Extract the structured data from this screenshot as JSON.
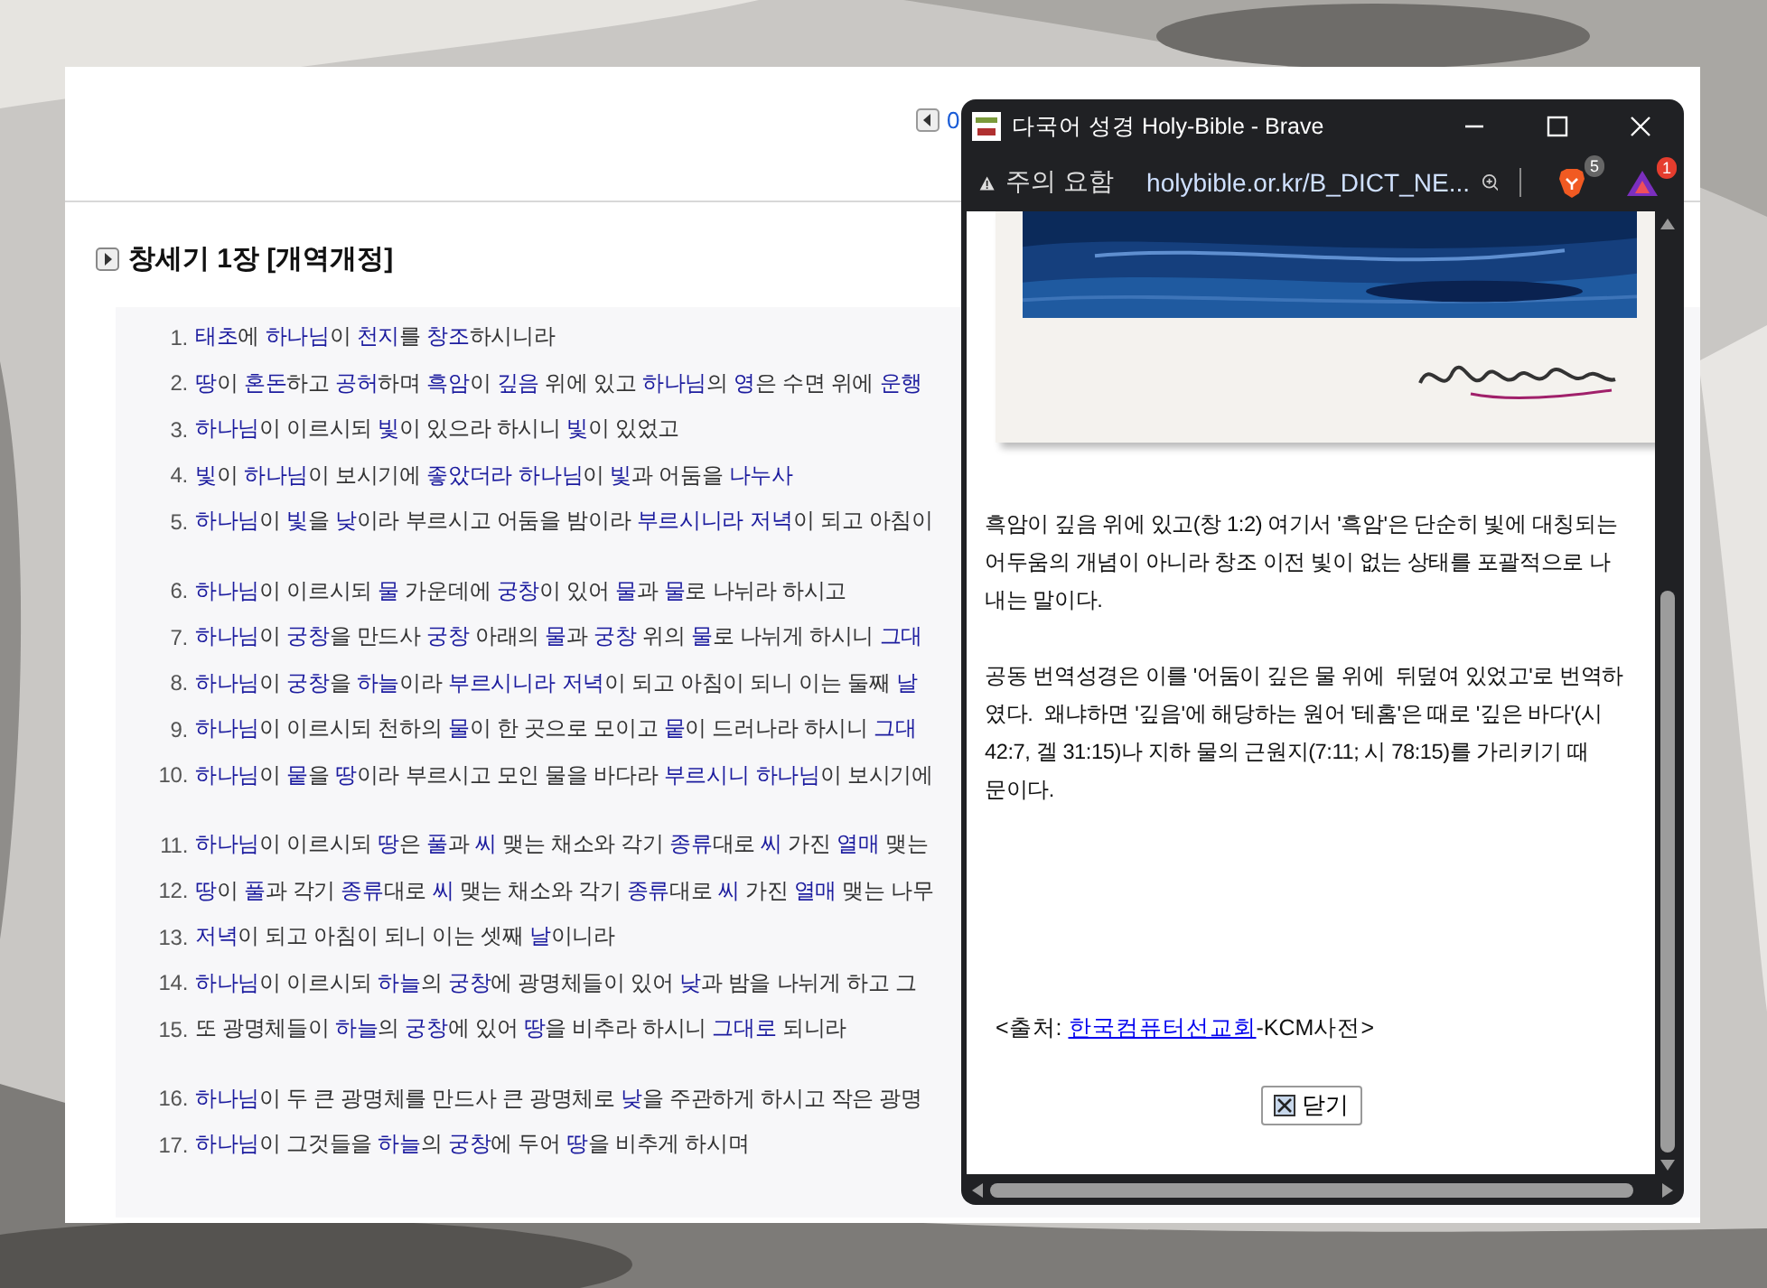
{
  "page": {
    "top_link": "0",
    "heading": "창세기 1장 [개역개정]",
    "verse_groups": [
      [
        {
          "number": "1.",
          "parts": [
            {
              "text": "태초",
              "link": true
            },
            {
              "text": "에 ",
              "link": false
            },
            {
              "text": "하나님",
              "link": true
            },
            {
              "text": "이 ",
              "link": false
            },
            {
              "text": "천지",
              "link": true
            },
            {
              "text": "를 ",
              "link": false
            },
            {
              "text": "창조",
              "link": true
            },
            {
              "text": "하시니라",
              "link": false
            }
          ]
        },
        {
          "number": "2.",
          "parts": [
            {
              "text": "땅",
              "link": true
            },
            {
              "text": "이 ",
              "link": false
            },
            {
              "text": "혼돈",
              "link": true
            },
            {
              "text": "하고 ",
              "link": false
            },
            {
              "text": "공허",
              "link": true
            },
            {
              "text": "하며 ",
              "link": false
            },
            {
              "text": "흑암",
              "link": true
            },
            {
              "text": "이 ",
              "link": false
            },
            {
              "text": "깊음",
              "link": true
            },
            {
              "text": " 위에 있고 ",
              "link": false
            },
            {
              "text": "하나님",
              "link": true
            },
            {
              "text": "의 ",
              "link": false
            },
            {
              "text": "영",
              "link": true
            },
            {
              "text": "은 수면 위에 ",
              "link": false
            },
            {
              "text": "운행",
              "link": true
            }
          ]
        },
        {
          "number": "3.",
          "parts": [
            {
              "text": "하나님",
              "link": true
            },
            {
              "text": "이 이르시되 ",
              "link": false
            },
            {
              "text": "빛",
              "link": true
            },
            {
              "text": "이 있으라 하시니 ",
              "link": false
            },
            {
              "text": "빛",
              "link": true
            },
            {
              "text": "이 있었고",
              "link": false
            }
          ]
        },
        {
          "number": "4.",
          "parts": [
            {
              "text": "빛",
              "link": true
            },
            {
              "text": "이 ",
              "link": false
            },
            {
              "text": "하나님",
              "link": true
            },
            {
              "text": "이 보시기에 ",
              "link": false
            },
            {
              "text": "좋았더라",
              "link": true
            },
            {
              "text": "하나님",
              "link": true
            },
            {
              "text": "이 ",
              "link": false
            },
            {
              "text": "빛",
              "link": true
            },
            {
              "text": "과 어둠을 ",
              "link": false
            },
            {
              "text": "나누사",
              "link": true
            }
          ]
        },
        {
          "number": "5.",
          "parts": [
            {
              "text": "하나님",
              "link": true
            },
            {
              "text": "이 ",
              "link": false
            },
            {
              "text": "빛",
              "link": true
            },
            {
              "text": "을 ",
              "link": false
            },
            {
              "text": "낮",
              "link": true
            },
            {
              "text": "이라 부르시고 어둠을 밤이라 ",
              "link": false
            },
            {
              "text": "부르시니라",
              "link": true
            },
            {
              "text": "저녁",
              "link": true
            },
            {
              "text": "이 되고 아침이",
              "link": false
            }
          ]
        }
      ],
      [
        {
          "number": "6.",
          "parts": [
            {
              "text": "하나님",
              "link": true
            },
            {
              "text": "이 이르시되 ",
              "link": false
            },
            {
              "text": "물",
              "link": true
            },
            {
              "text": " 가운데에 ",
              "link": false
            },
            {
              "text": "궁창",
              "link": true
            },
            {
              "text": "이 있어 ",
              "link": false
            },
            {
              "text": "물",
              "link": true
            },
            {
              "text": "과 ",
              "link": false
            },
            {
              "text": "물",
              "link": true
            },
            {
              "text": "로 나뉘라 하시고",
              "link": false
            }
          ]
        },
        {
          "number": "7.",
          "parts": [
            {
              "text": "하나님",
              "link": true
            },
            {
              "text": "이 ",
              "link": false
            },
            {
              "text": "궁창",
              "link": true
            },
            {
              "text": "을 만드사 ",
              "link": false
            },
            {
              "text": "궁창",
              "link": true
            },
            {
              "text": " 아래의 ",
              "link": false
            },
            {
              "text": "물",
              "link": true
            },
            {
              "text": "과 ",
              "link": false
            },
            {
              "text": "궁창",
              "link": true
            },
            {
              "text": " 위의 ",
              "link": false
            },
            {
              "text": "물",
              "link": true
            },
            {
              "text": "로 나뉘게 하시니 ",
              "link": false
            },
            {
              "text": "그대",
              "link": true
            }
          ]
        },
        {
          "number": "8.",
          "parts": [
            {
              "text": "하나님",
              "link": true
            },
            {
              "text": "이 ",
              "link": false
            },
            {
              "text": "궁창",
              "link": true
            },
            {
              "text": "을 ",
              "link": false
            },
            {
              "text": "하늘",
              "link": true
            },
            {
              "text": "이라 ",
              "link": false
            },
            {
              "text": "부르시니라",
              "link": true
            },
            {
              "text": "저녁",
              "link": true
            },
            {
              "text": "이 되고 아침이 되니 이는 둘째 ",
              "link": false
            },
            {
              "text": "날",
              "link": true
            }
          ]
        },
        {
          "number": "9.",
          "parts": [
            {
              "text": "하나님",
              "link": true
            },
            {
              "text": "이 이르시되 천하의 ",
              "link": false
            },
            {
              "text": "물",
              "link": true
            },
            {
              "text": "이 한 곳으로 모이고 ",
              "link": false
            },
            {
              "text": "뭍",
              "link": true
            },
            {
              "text": "이 드러나라 하시니 ",
              "link": false
            },
            {
              "text": "그대",
              "link": true
            }
          ]
        },
        {
          "number": "10.",
          "parts": [
            {
              "text": "하나님",
              "link": true
            },
            {
              "text": "이 ",
              "link": false
            },
            {
              "text": "뭍",
              "link": true
            },
            {
              "text": "을 ",
              "link": false
            },
            {
              "text": "땅",
              "link": true
            },
            {
              "text": "이라 부르시고 모인 물을 바다라 ",
              "link": false
            },
            {
              "text": "부르시니",
              "link": true
            },
            {
              "text": "하나님",
              "link": true
            },
            {
              "text": "이 보시기에",
              "link": false
            }
          ]
        }
      ],
      [
        {
          "number": "11.",
          "parts": [
            {
              "text": "하나님",
              "link": true
            },
            {
              "text": "이 이르시되 ",
              "link": false
            },
            {
              "text": "땅",
              "link": true
            },
            {
              "text": "은 ",
              "link": false
            },
            {
              "text": "풀",
              "link": true
            },
            {
              "text": "과 ",
              "link": false
            },
            {
              "text": "씨",
              "link": true
            },
            {
              "text": " 맺는 채소와 각기 ",
              "link": false
            },
            {
              "text": "종류",
              "link": true
            },
            {
              "text": "대로 ",
              "link": false
            },
            {
              "text": "씨",
              "link": true
            },
            {
              "text": " 가진 ",
              "link": false
            },
            {
              "text": "열매",
              "link": true
            },
            {
              "text": " 맺는",
              "link": false
            }
          ]
        },
        {
          "number": "12.",
          "parts": [
            {
              "text": "땅",
              "link": true
            },
            {
              "text": "이 ",
              "link": false
            },
            {
              "text": "풀",
              "link": true
            },
            {
              "text": "과 각기 ",
              "link": false
            },
            {
              "text": "종류",
              "link": true
            },
            {
              "text": "대로 ",
              "link": false
            },
            {
              "text": "씨",
              "link": true
            },
            {
              "text": " 맺는 채소와 각기 ",
              "link": false
            },
            {
              "text": "종류",
              "link": true
            },
            {
              "text": "대로 ",
              "link": false
            },
            {
              "text": "씨",
              "link": true
            },
            {
              "text": " 가진 ",
              "link": false
            },
            {
              "text": "열매",
              "link": true
            },
            {
              "text": " 맺는 나무",
              "link": false
            }
          ]
        },
        {
          "number": "13.",
          "parts": [
            {
              "text": "저녁",
              "link": true
            },
            {
              "text": "이 되고 아침이 되니 이는 셋째 ",
              "link": false
            },
            {
              "text": "날",
              "link": true
            },
            {
              "text": "이니라",
              "link": false
            }
          ]
        },
        {
          "number": "14.",
          "parts": [
            {
              "text": "하나님",
              "link": true
            },
            {
              "text": "이 이르시되 ",
              "link": false
            },
            {
              "text": "하늘",
              "link": true
            },
            {
              "text": "의 ",
              "link": false
            },
            {
              "text": "궁창",
              "link": true
            },
            {
              "text": "에 광명체들이 있어 ",
              "link": false
            },
            {
              "text": "낮",
              "link": true
            },
            {
              "text": "과 밤을 나뉘게 하고 그",
              "link": false
            }
          ]
        },
        {
          "number": "15.",
          "parts": [
            {
              "text": "또 광명체들이 ",
              "link": false
            },
            {
              "text": "하늘",
              "link": true
            },
            {
              "text": "의 ",
              "link": false
            },
            {
              "text": "궁창",
              "link": true
            },
            {
              "text": "에 있어 ",
              "link": false
            },
            {
              "text": "땅",
              "link": true
            },
            {
              "text": "을 비추라 하시니 ",
              "link": false
            },
            {
              "text": "그대로",
              "link": true
            },
            {
              "text": " 되니라",
              "link": false
            }
          ]
        }
      ],
      [
        {
          "number": "16.",
          "parts": [
            {
              "text": "하나님",
              "link": true
            },
            {
              "text": "이 두 큰 광명체를 만드사 큰 광명체로 ",
              "link": false
            },
            {
              "text": "낮",
              "link": true
            },
            {
              "text": "을 주관하게 하시고 작은 광명",
              "link": false
            }
          ]
        },
        {
          "number": "17.",
          "parts": [
            {
              "text": "하나님",
              "link": true
            },
            {
              "text": "이 그것들을 ",
              "link": false
            },
            {
              "text": "하늘",
              "link": true
            },
            {
              "text": "의 ",
              "link": false
            },
            {
              "text": "궁창",
              "link": true
            },
            {
              "text": "에 두어 ",
              "link": false
            },
            {
              "text": "땅",
              "link": true
            },
            {
              "text": "을 비추게 하시며",
              "link": false
            }
          ]
        }
      ]
    ]
  },
  "popup": {
    "title": "다국어 성경 Holy-Bible - Brave",
    "security_label": "주의 요함",
    "url": "holybible.or.kr/B_DICT_NE...",
    "shields_badge": "5",
    "rewards_badge": "1",
    "paragraphs": [
      {
        "lines": [
          "흑암이 깊음 위에 있고(창 1:2) 여기서 '흑암'은 단순히 빛에 대칭되는",
          "어두움의 개념이 아니라 창조 이전 빛이 없는 상태를 포괄적으로 나",
          "내는 말이다."
        ]
      },
      {
        "lines": [
          "공동 번역성경은 이를 '어둠이 깊은 물 위에  뒤덮여 있었고'로 번역하",
          "였다.  왜냐하면 '깊음'에 해당하는 원어 '테홈'은 때로 '깊은 바다'(시",
          "42:7, 겔 31:15)나 지하 물의 근원지(7:11; 시 78:15)를 가리키기 때",
          "문이다."
        ]
      }
    ],
    "source": {
      "prefix": "<출처: ",
      "link": "한국컴퓨터선교회",
      "suffix": "-KCM사전>"
    },
    "close_button": "닫기"
  }
}
